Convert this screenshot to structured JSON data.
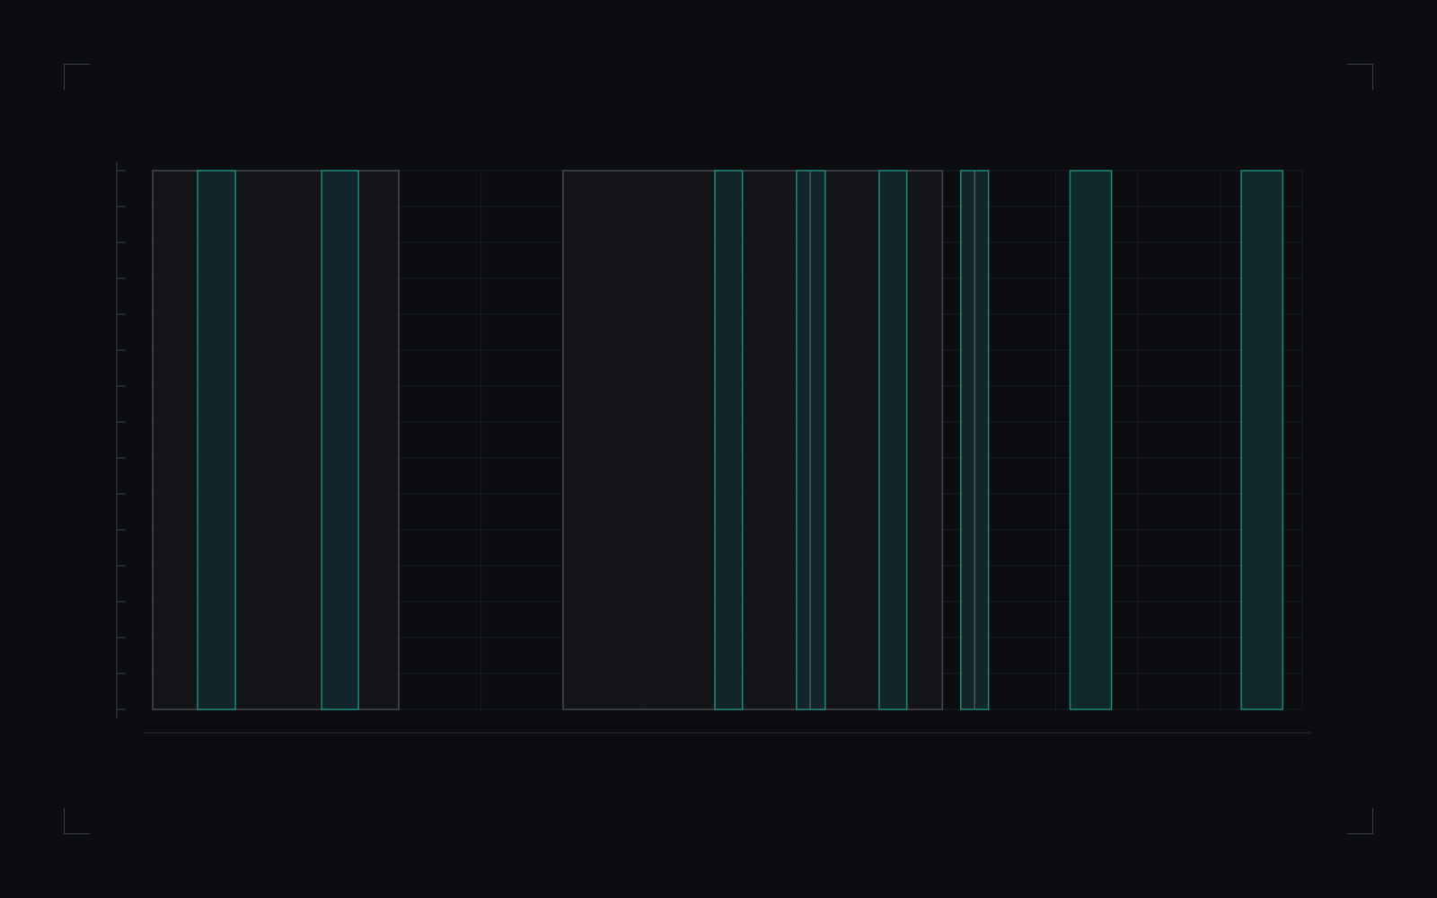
{
  "colors": {
    "background": "#0b0d11",
    "grid": "#1a1d22",
    "frame": "#3a3f47",
    "region_fill": "#15171b",
    "region_stroke": "#46494f",
    "accent": "#1d8a78",
    "accent_fill": "#102a2c"
  },
  "view": {
    "x_range": [
      0,
      1000
    ],
    "y_range": [
      0,
      1
    ]
  },
  "regions": [
    {
      "start": 0,
      "end": 214
    },
    {
      "start": 357,
      "end": 687
    }
  ],
  "bands": [
    {
      "start": 39,
      "end": 72,
      "in_region": true
    },
    {
      "start": 147,
      "end": 179,
      "in_region": true
    },
    {
      "start": 489,
      "end": 513,
      "in_region": true
    },
    {
      "start": 560,
      "end": 585,
      "in_region": true,
      "divider": 572
    },
    {
      "start": 632,
      "end": 656,
      "in_region": true
    },
    {
      "start": 703,
      "end": 727,
      "in_region": true,
      "divider": 715
    },
    {
      "start": 798,
      "end": 834,
      "in_region": false
    },
    {
      "start": 947,
      "end": 983,
      "in_region": false
    }
  ]
}
